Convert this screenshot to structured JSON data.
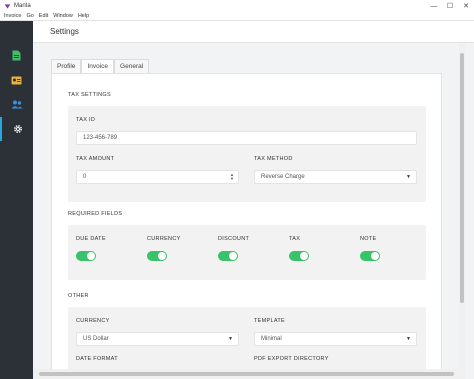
{
  "window": {
    "title": "Manta",
    "controls": [
      "—",
      "☐",
      "✕"
    ]
  },
  "menu": [
    "Invoice",
    "Go",
    "Edit",
    "Window",
    "Help"
  ],
  "sidebar": {
    "items": [
      {
        "icon": "invoice-icon",
        "active": false
      },
      {
        "icon": "contacts-card-icon",
        "active": false
      },
      {
        "icon": "users-icon",
        "active": false
      },
      {
        "icon": "gear-icon",
        "active": true
      }
    ],
    "accent": "#26a8de"
  },
  "header": {
    "title": "Settings"
  },
  "tabs": [
    {
      "label": "Profile",
      "active": false
    },
    {
      "label": "Invoice",
      "active": true
    },
    {
      "label": "General",
      "active": false
    }
  ],
  "tax_settings": {
    "title": "TAX SETTINGS",
    "tax_id": {
      "label": "TAX ID",
      "value": "123-456-789"
    },
    "tax_amount": {
      "label": "TAX AMOUNT",
      "value": "0"
    },
    "tax_method": {
      "label": "TAX METHOD",
      "value": "Reverse Charge"
    }
  },
  "required_fields": {
    "title": "REQUIRED FIELDS",
    "items": [
      {
        "label": "DUE DATE",
        "on": true
      },
      {
        "label": "CURRENCY",
        "on": true
      },
      {
        "label": "DISCOUNT",
        "on": true
      },
      {
        "label": "TAX",
        "on": true
      },
      {
        "label": "NOTE",
        "on": true
      }
    ],
    "toggle_color": "#38c26a"
  },
  "other": {
    "title": "OTHER",
    "currency": {
      "label": "CURRENCY",
      "value": "US Dollar"
    },
    "template": {
      "label": "TEMPLATE",
      "value": "Minimal"
    },
    "date_format": {
      "label": "DATE FORMAT"
    },
    "pdf_export_directory": {
      "label": "PDF EXPORT DIRECTORY"
    }
  }
}
